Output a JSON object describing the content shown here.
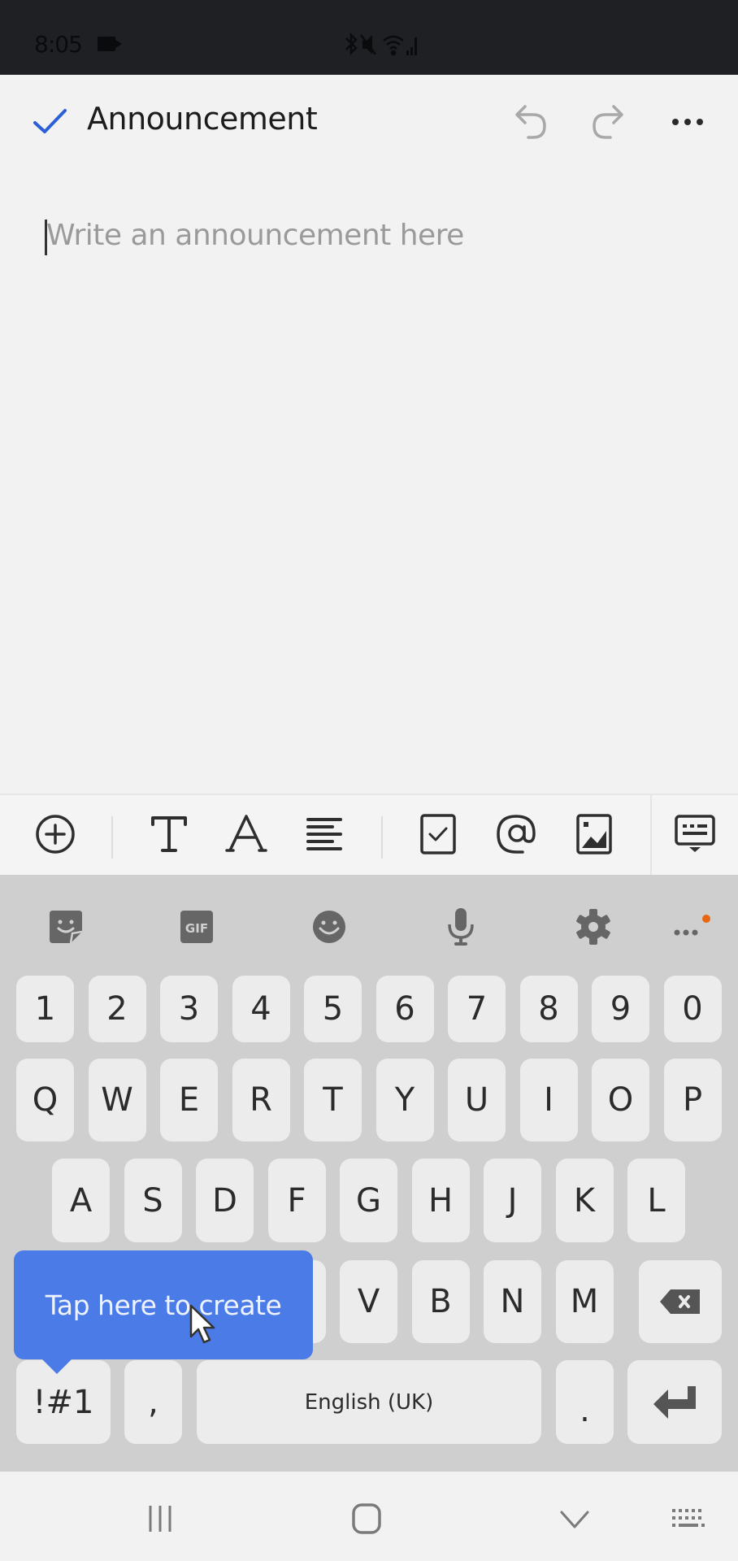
{
  "status_bar": {
    "time": "8:05",
    "icons": [
      "recording-icon",
      "bluetooth-icon",
      "mute-icon",
      "wifi-icon",
      "signal-icon"
    ]
  },
  "header": {
    "title": "Announcement",
    "check_icon": "check-icon",
    "undo_icon": "undo-icon",
    "redo_icon": "redo-icon",
    "more_icon": "more-horizontal-icon",
    "accent_color": "#2b5fd9"
  },
  "editor": {
    "placeholder": "Write an announcement here",
    "value": ""
  },
  "format_toolbar": {
    "items": [
      {
        "name": "insert",
        "icon": "add-circle-icon"
      },
      {
        "name": "text-style",
        "icon": "text-style-icon"
      },
      {
        "name": "font",
        "icon": "font-icon"
      },
      {
        "name": "align",
        "icon": "align-left-icon"
      },
      {
        "name": "checklist",
        "icon": "checkbox-icon"
      },
      {
        "name": "mention",
        "icon": "at-sign-icon"
      },
      {
        "name": "image",
        "icon": "image-icon"
      },
      {
        "name": "keyboard-toggle",
        "icon": "keyboard-hide-icon"
      }
    ]
  },
  "keyboard": {
    "toolbar": [
      {
        "name": "sticker",
        "icon": "sticker-icon"
      },
      {
        "name": "gif",
        "icon": "gif-icon",
        "label": "GIF"
      },
      {
        "name": "emoji",
        "icon": "emoji-icon"
      },
      {
        "name": "voice",
        "icon": "microphone-icon"
      },
      {
        "name": "settings",
        "icon": "gear-icon"
      },
      {
        "name": "more",
        "icon": "more-icon",
        "badge_color": "#e8660f"
      }
    ],
    "rows": {
      "numbers": [
        "1",
        "2",
        "3",
        "4",
        "5",
        "6",
        "7",
        "8",
        "9",
        "0"
      ],
      "row1": [
        "Q",
        "W",
        "E",
        "R",
        "T",
        "Y",
        "U",
        "I",
        "O",
        "P"
      ],
      "row2": [
        "A",
        "S",
        "D",
        "F",
        "G",
        "H",
        "J",
        "K",
        "L"
      ],
      "row3": [
        "V",
        "B",
        "N",
        "M"
      ]
    },
    "symbols_label": "!#1",
    "comma_label": ",",
    "space_label": "English (UK)",
    "period_label": ".",
    "backspace_icon": "backspace-icon",
    "enter_icon": "enter-icon"
  },
  "tooltip": {
    "text": "Tap here to create",
    "color": "#4a7be6"
  },
  "nav_bar": {
    "recents_icon": "recents-icon",
    "home_icon": "home-icon",
    "back_icon": "chevron-down-icon",
    "keyboard_icon": "keyboard-icon"
  }
}
